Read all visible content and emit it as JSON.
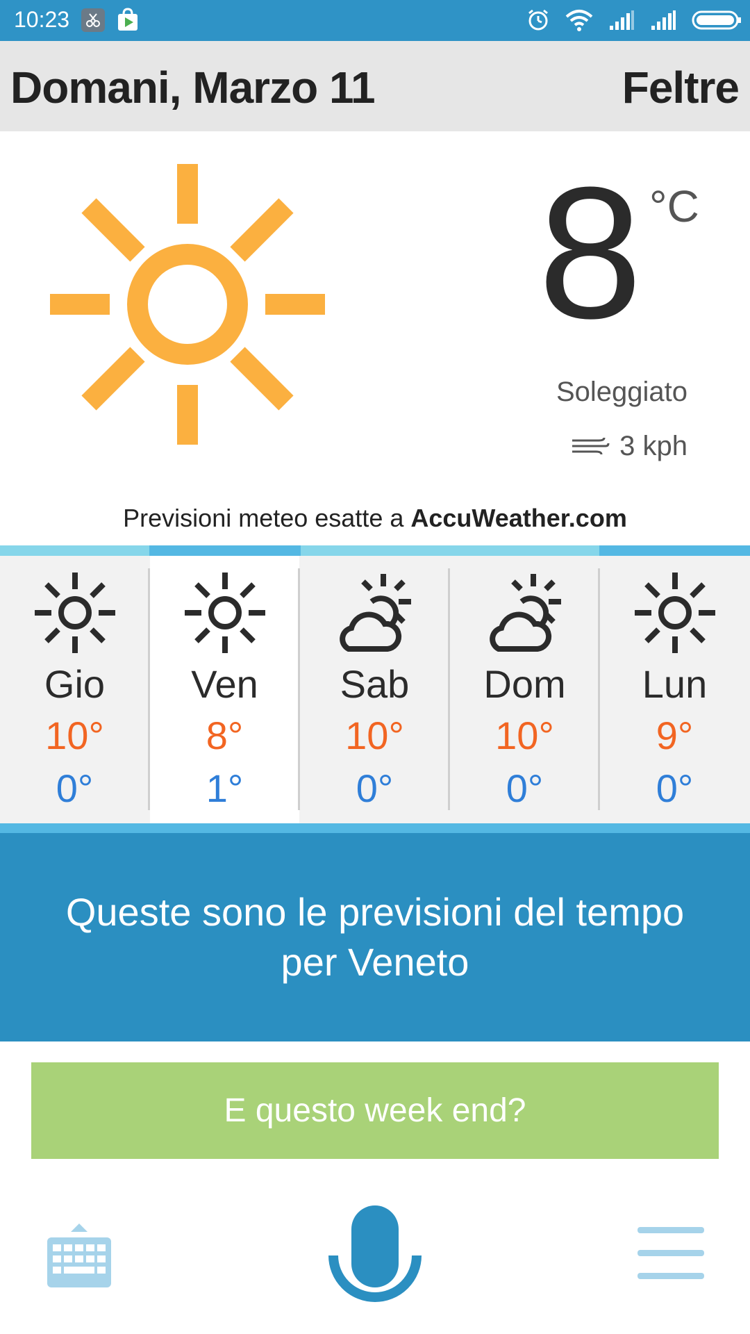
{
  "status_bar": {
    "time": "10:23",
    "icons": [
      "scissors-app-icon",
      "play-store-icon",
      "alarm-icon",
      "wifi-icon",
      "signal-icon",
      "signal-icon",
      "battery-icon"
    ]
  },
  "header": {
    "date": "Domani, Marzo 11",
    "city": "Feltre"
  },
  "current": {
    "icon": "sun-icon",
    "temperature": "8",
    "unit": "°C",
    "condition": "Soleggiato",
    "wind": "3 kph"
  },
  "attribution": {
    "prefix": "Previsioni meteo esatte a ",
    "brand": "AccuWeather.com"
  },
  "forecast": [
    {
      "day": "Gio",
      "icon": "sun-icon",
      "high": "10°",
      "low": "0°",
      "selected": false
    },
    {
      "day": "Ven",
      "icon": "sun-icon",
      "high": "8°",
      "low": "1°",
      "selected": true
    },
    {
      "day": "Sab",
      "icon": "partly-cloudy-icon",
      "high": "10°",
      "low": "0°",
      "selected": false
    },
    {
      "day": "Dom",
      "icon": "partly-cloudy-icon",
      "high": "10°",
      "low": "0°",
      "selected": false
    },
    {
      "day": "Lun",
      "icon": "sun-icon",
      "high": "9°",
      "low": "0°",
      "selected": false
    }
  ],
  "banner": {
    "text": "Queste sono le previsioni del tempo per Veneto"
  },
  "suggestion": {
    "label": "E questo week end?"
  },
  "bottom_bar": {
    "icons": [
      "keyboard-icon",
      "microphone-icon",
      "menu-icon"
    ]
  },
  "colors": {
    "status_bar": "#2f93c6",
    "accent_blue": "#2b8fc1",
    "sun": "#fbb040",
    "high_temp": "#f26522",
    "low_temp": "#2f7ed8",
    "suggestion_green": "#a9d278"
  }
}
